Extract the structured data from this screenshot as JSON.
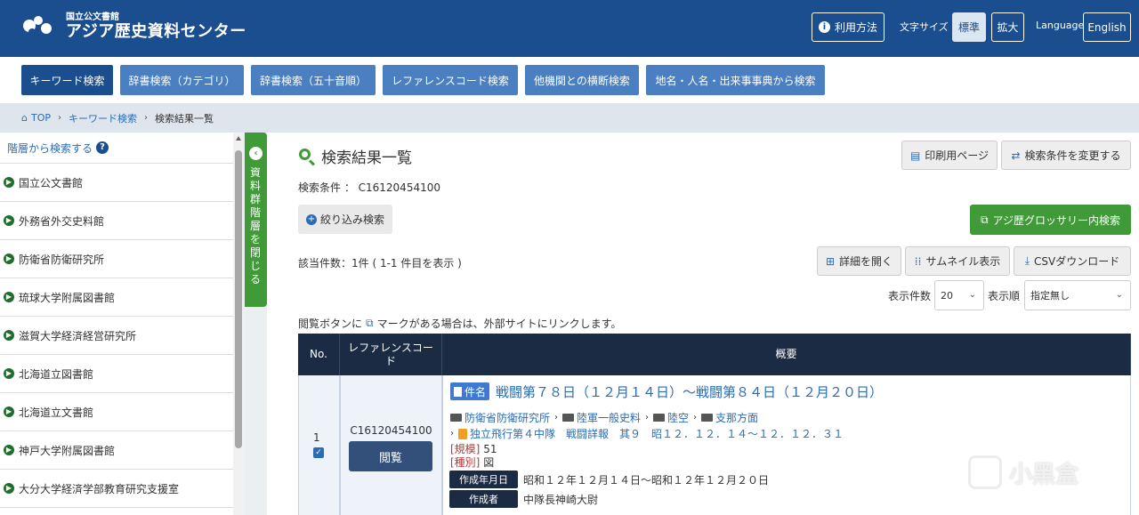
{
  "header": {
    "logo_small": "国立公文書館",
    "logo_big": "アジア歴史資料センター",
    "help_label": "利用方法",
    "font_size_label": "文字サイズ",
    "font_standard": "標準",
    "font_large": "拡大",
    "language_label": "Language",
    "language_value": "English"
  },
  "tabs": [
    {
      "label": "キーワード検索"
    },
    {
      "label": "辞書検索（カテゴリ）"
    },
    {
      "label": "辞書検索（五十音順）"
    },
    {
      "label": "レファレンスコード検索"
    },
    {
      "label": "他機関との横断検索"
    },
    {
      "label": "地名・人名・出来事事典から検索"
    }
  ],
  "breadcrumb": {
    "top": "TOP",
    "keyword": "キーワード検索",
    "current": "検索結果一覧"
  },
  "sidebar": {
    "title": "階層から検索する",
    "toggle_label": "資料群階層を閉じる",
    "items": [
      {
        "label": "国立公文書館"
      },
      {
        "label": "外務省外交史料館"
      },
      {
        "label": "防衛省防衛研究所"
      },
      {
        "label": "琉球大学附属図書館"
      },
      {
        "label": "滋賀大学経済経営研究所"
      },
      {
        "label": "北海道立図書館"
      },
      {
        "label": "北海道立文書館"
      },
      {
        "label": "神戸大学附属図書館"
      },
      {
        "label": "大分大学経済学部教育研究支援室"
      }
    ]
  },
  "main": {
    "title": "検索結果一覧",
    "print_label": "印刷用ページ",
    "change_label": "検索条件を変更する",
    "condition": "検索条件 ： C16120454100",
    "narrow_label": "絞り込み検索",
    "glossary_label": "アジ歴グロッサリー内検索",
    "count": "該当件数：1件 ( 1-1 件目を表示 )",
    "detail_label": "詳細を開く",
    "thumb_label": "サムネイル表示",
    "csv_label": "CSVダウンロード",
    "per_page_label": "表示件数",
    "per_page_value": "20",
    "order_label": "表示順",
    "order_value": "指定無し",
    "note_prefix": "閲覧ボタンに",
    "note_suffix": "マークがある場合は、外部サイトにリンクします。"
  },
  "table": {
    "headers": {
      "no": "No.",
      "ref": "レファレンスコード",
      "summary": "概要"
    },
    "row": {
      "no": "1",
      "refcode": "C16120454100",
      "view_label": "閲覧",
      "kenmei_badge": "件名",
      "title": "戦闘第７８日（１２月１４日）～戦闘第８４日（１２月２０日）",
      "path": [
        "防衛省防衛研究所",
        "陸軍一般史料",
        "陸空",
        "支那方面"
      ],
      "subpath": "独立飛行第４中隊　戦闘詳報　其９　昭１２．１２．１４～１２．１２．３１",
      "scale_key": "[規模]",
      "scale_val": "51",
      "type_key": "[種別]",
      "type_val": "図",
      "date_badge": "作成年月日",
      "date_val": "昭和１２年１２月１４日～昭和１２年１２月２０日",
      "author_badge": "作成者",
      "author_val": "中隊長神崎大尉"
    }
  },
  "watermark": "小黑盒",
  "colors": {
    "header_bg": "#1a4e8e",
    "tab_bg": "#4a7fc1",
    "green": "#3f9a37",
    "table_head": "#1c2b44"
  }
}
